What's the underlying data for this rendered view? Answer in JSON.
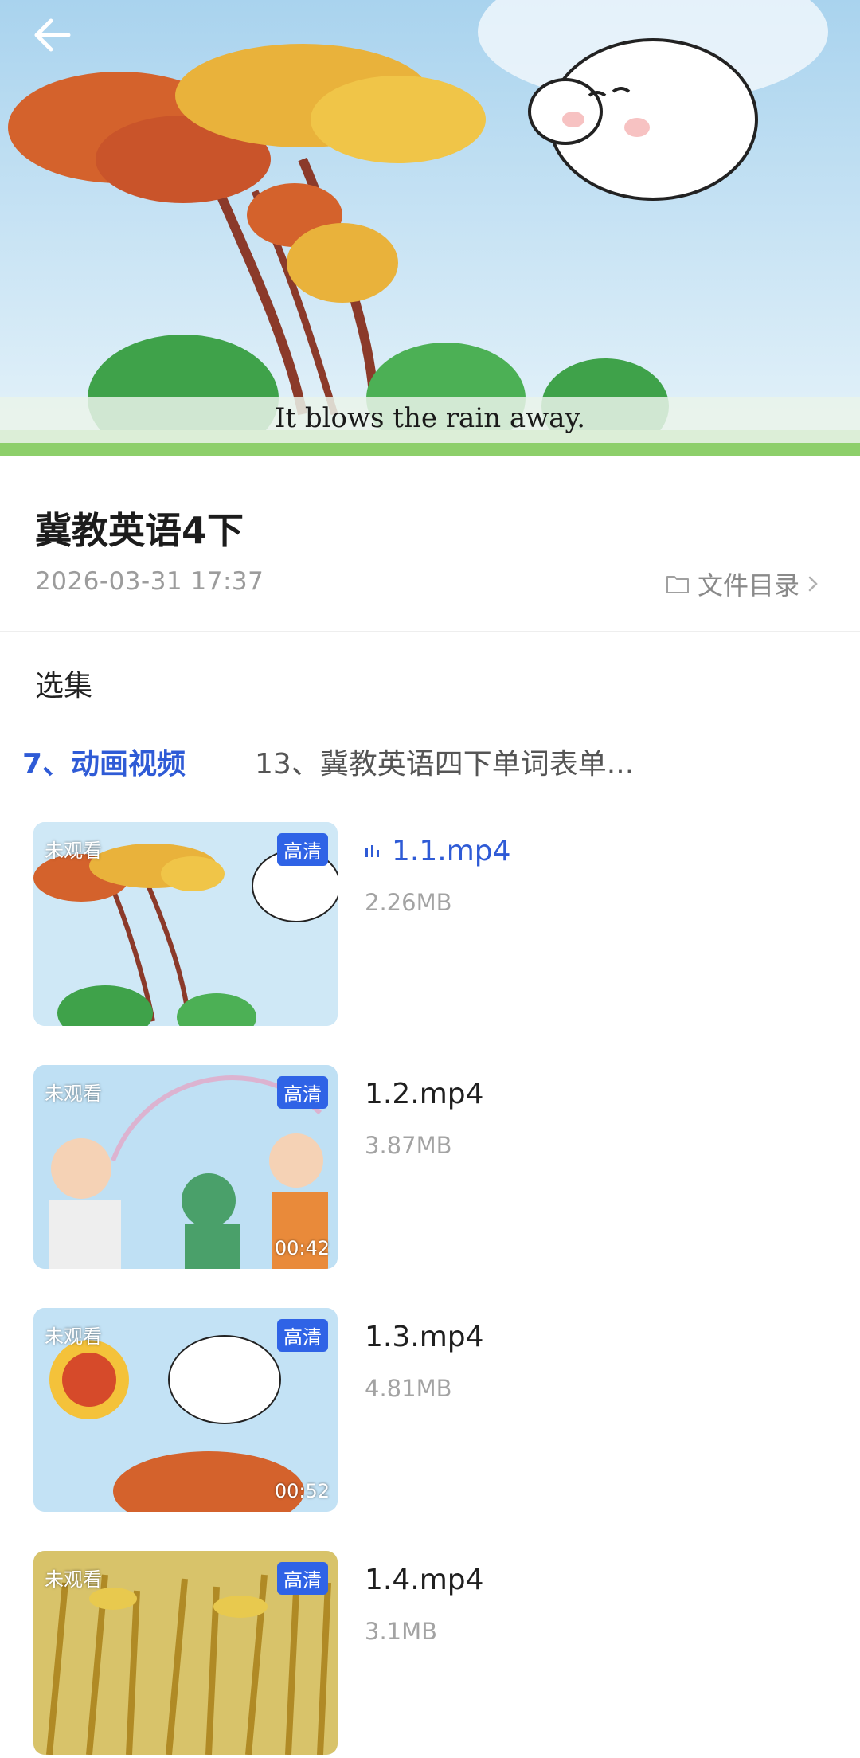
{
  "player": {
    "subtitle": "It blows the rain away.",
    "back_icon": "arrow-left-icon"
  },
  "info": {
    "title": "冀教英语4下",
    "date": "2026-03-31 17:37",
    "directory_label": "文件目录",
    "directory_icons": [
      "folder-icon",
      "chevron-right-icon"
    ]
  },
  "section_label": "选集",
  "tabs": [
    {
      "label": "7、动画视频",
      "active": true
    },
    {
      "label": "13、冀教英语四下单词表单...",
      "active": false
    }
  ],
  "episodes": [
    {
      "name": "1.1.mp4",
      "size": "2.26MB",
      "badge": "未观看",
      "quality": "高清",
      "duration": "",
      "playing": true
    },
    {
      "name": "1.2.mp4",
      "size": "3.87MB",
      "badge": "未观看",
      "quality": "高清",
      "duration": "00:42",
      "playing": false
    },
    {
      "name": "1.3.mp4",
      "size": "4.81MB",
      "badge": "未观看",
      "quality": "高清",
      "duration": "00:52",
      "playing": false
    },
    {
      "name": "1.4.mp4",
      "size": "3.1MB",
      "badge": "未观看",
      "quality": "高清",
      "duration": "",
      "playing": false
    }
  ],
  "colors": {
    "accent": "#2f5bd6",
    "hd_badge": "#2f63e6",
    "meta_text": "#9c9c9c"
  }
}
